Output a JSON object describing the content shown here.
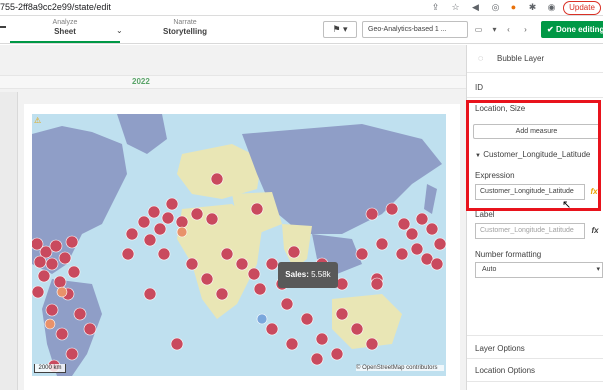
{
  "browser": {
    "url": "755-2ff8a9cc2e99/state/edit",
    "update_label": "Update"
  },
  "toolbar": {
    "modes": [
      {
        "sub": "Analyze",
        "label": "Sheet"
      },
      {
        "sub": "Narrate",
        "label": "Storytelling"
      }
    ],
    "sheet_selector": "Geo-Analytics-based 1 ...",
    "done_label": "Done editing"
  },
  "canvas": {
    "year": "2022"
  },
  "map": {
    "tooltip_label": "Sales:",
    "tooltip_value": "5.58k",
    "scale": "2000 km",
    "attribution": "© OpenStreetMap contributors"
  },
  "panel": {
    "title": "Bubble Layer",
    "id_label": "ID",
    "location_size_label": "Location, Size",
    "add_measure_label": "Add measure",
    "dimension_label": "Customer_Longitude_Latitude",
    "expression_label": "Expression",
    "expression_value": "Customer_Longitude_Latitude",
    "label_label": "Label",
    "label_placeholder": "Customer_Longitude_Latitude",
    "number_formatting_label": "Number formatting",
    "number_formatting_value": "Auto",
    "layer_options_label": "Layer Options",
    "location_options_label": "Location Options"
  },
  "colors": {
    "accent": "#009845",
    "bubble": "#c94a5e",
    "highlight_box": "#e8131c"
  }
}
